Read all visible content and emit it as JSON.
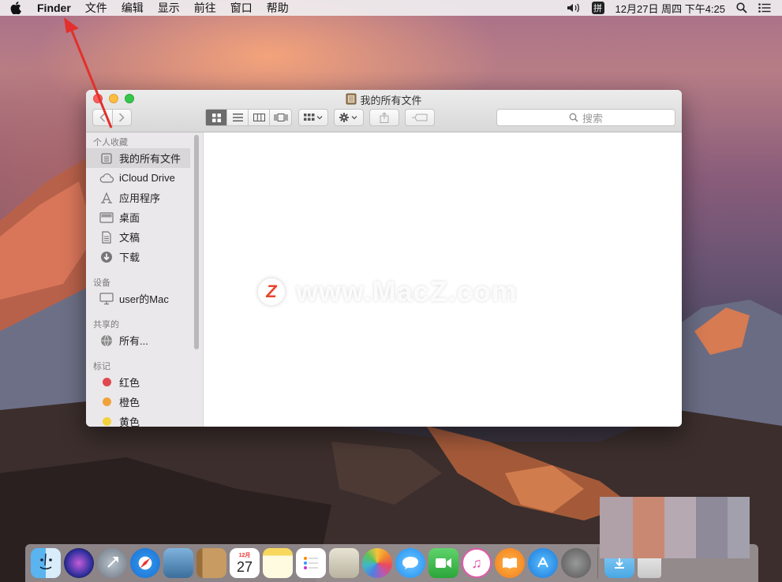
{
  "menubar": {
    "app_name": "Finder",
    "menus": [
      "文件",
      "编辑",
      "显示",
      "前往",
      "窗口",
      "帮助"
    ],
    "datetime": "12月27日 周四 下午4:25",
    "input_method": "拼"
  },
  "window": {
    "title": "我的所有文件",
    "search_placeholder": "搜索",
    "sidebar": {
      "favorites_title": "个人收藏",
      "favorites": [
        {
          "label": "我的所有文件",
          "icon": "all-files-icon"
        },
        {
          "label": "iCloud Drive",
          "icon": "cloud-icon"
        },
        {
          "label": "应用程序",
          "icon": "applications-icon"
        },
        {
          "label": "桌面",
          "icon": "desktop-icon"
        },
        {
          "label": "文稿",
          "icon": "documents-icon"
        },
        {
          "label": "下载",
          "icon": "download-icon"
        }
      ],
      "devices_title": "设备",
      "devices": [
        {
          "label": "user的Mac",
          "icon": "computer-icon"
        }
      ],
      "shared_title": "共享的",
      "shared": [
        {
          "label": "所有...",
          "icon": "network-icon"
        }
      ],
      "tags_title": "标记",
      "tags": [
        {
          "label": "红色",
          "color": "#e0484f"
        },
        {
          "label": "橙色",
          "color": "#f0a33a"
        },
        {
          "label": "黄色",
          "color": "#f4d23c"
        }
      ]
    }
  },
  "watermark": {
    "text": "www.MacZ.com",
    "logo_letter": "Z"
  },
  "dock": {
    "calendar_day": "27",
    "calendar_month": "12月"
  }
}
